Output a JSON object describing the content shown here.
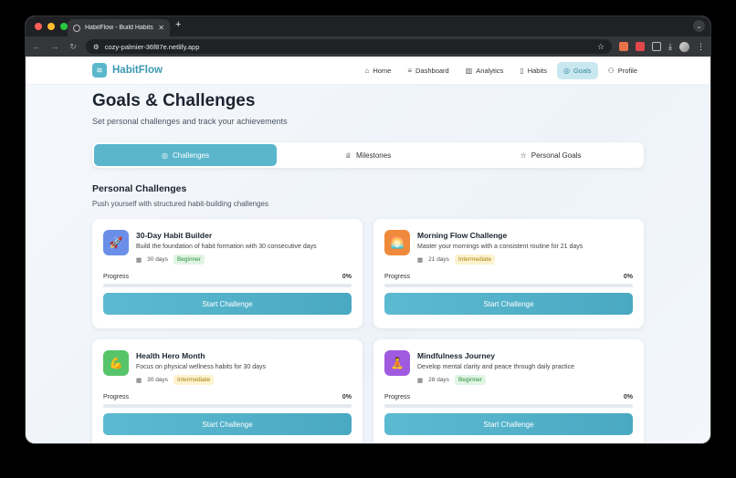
{
  "browser": {
    "tab_title": "HabitFlow - Build Habits Tha",
    "new_tab": "+",
    "url": "cozy-palmier-36f87e.netlify.app"
  },
  "app": {
    "brand": "HabitFlow",
    "nav": [
      {
        "label": "Home",
        "icon": "home-icon"
      },
      {
        "label": "Dashboard",
        "icon": "dashboard-icon"
      },
      {
        "label": "Analytics",
        "icon": "analytics-icon"
      },
      {
        "label": "Habits",
        "icon": "book-icon"
      },
      {
        "label": "Goals",
        "icon": "target-icon",
        "active": true
      },
      {
        "label": "Profile",
        "icon": "user-icon"
      }
    ]
  },
  "page": {
    "title": "Goals & Challenges",
    "subtitle": "Set personal challenges and track your achievements",
    "tabs": [
      {
        "label": "Challenges",
        "icon": "target-icon",
        "active": true
      },
      {
        "label": "Milestones",
        "icon": "trophy-icon"
      },
      {
        "label": "Personal Goals",
        "icon": "star-icon"
      }
    ],
    "section_title": "Personal Challenges",
    "section_subtitle": "Push yourself with structured habit-building challenges"
  },
  "challenges": [
    {
      "title": "30-Day Habit Builder",
      "desc": "Build the foundation of habit formation with 30 consecutive days",
      "days": "30 days",
      "level": "Beginner",
      "level_kind": "beg",
      "icon": "rocket-icon",
      "icon_glyph": "🚀",
      "icon_color": "#6b8fe8",
      "progress_label": "Progress",
      "progress": "0%",
      "progress_value": 0,
      "button": "Start Challenge"
    },
    {
      "title": "Morning Flow Challenge",
      "desc": "Master your mornings with a consistent routine for 21 days",
      "days": "21 days",
      "level": "Intermediate",
      "level_kind": "int",
      "icon": "sunrise-icon",
      "icon_glyph": "🌅",
      "icon_color": "#ef8a3c",
      "progress_label": "Progress",
      "progress": "0%",
      "progress_value": 0,
      "button": "Start Challenge"
    },
    {
      "title": "Health Hero Month",
      "desc": "Focus on physical wellness habits for 30 days",
      "days": "30 days",
      "level": "Intermediate",
      "level_kind": "int",
      "icon": "muscle-icon",
      "icon_glyph": "💪",
      "icon_color": "#58c46a",
      "progress_label": "Progress",
      "progress": "0%",
      "progress_value": 0,
      "button": "Start Challenge"
    },
    {
      "title": "Mindfulness Journey",
      "desc": "Develop mental clarity and peace through daily practice",
      "days": "28 days",
      "level": "Beginner",
      "level_kind": "beg",
      "icon": "meditation-icon",
      "icon_glyph": "🧘",
      "icon_color": "#a05ae0",
      "progress_label": "Progress",
      "progress": "0%",
      "progress_value": 0,
      "button": "Start Challenge"
    }
  ]
}
